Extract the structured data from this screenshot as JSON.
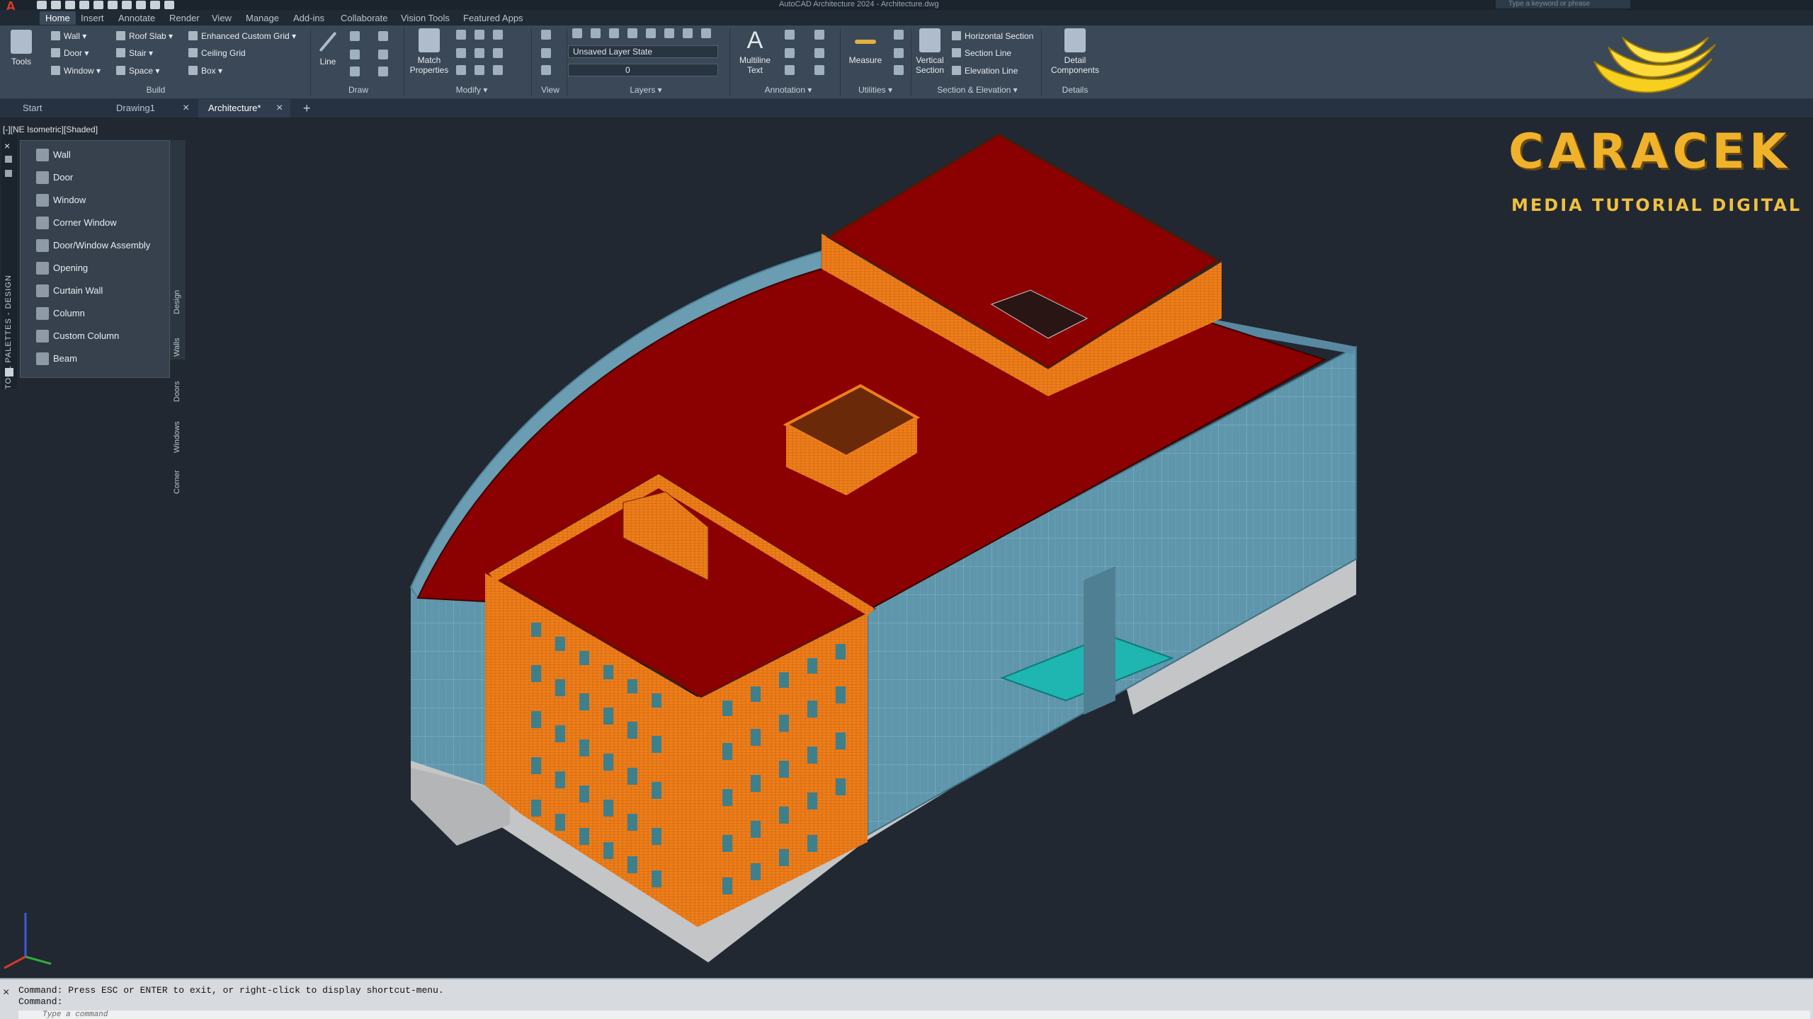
{
  "titlebar": {
    "title": "AutoCAD Architecture 2024 - Architecture.dwg",
    "search_placeholder": "Type a keyword or phrase"
  },
  "ribbon_tabs": [
    "Home",
    "Insert",
    "Annotate",
    "Render",
    "View",
    "Manage",
    "Add-ins",
    "Collaborate",
    "Vision Tools",
    "Featured Apps"
  ],
  "ribbon": {
    "tools_label": "Tools",
    "build": {
      "wall": "Wall",
      "door": "Door",
      "window": "Window",
      "roof_slab": "Roof Slab",
      "stair": "Stair",
      "space": "Space",
      "enhanced_custom_grid": "Enhanced Custom Grid",
      "ceiling_grid": "Ceiling Grid",
      "box": "Box",
      "title": "Build"
    },
    "draw": {
      "line": "Line",
      "title": "Draw"
    },
    "modify": {
      "match_properties": "Match Properties",
      "title": "Modify ▾"
    },
    "view": {
      "title": "View"
    },
    "layers": {
      "layer_state": "Unsaved Layer State",
      "layer_current": "0",
      "title": "Layers ▾"
    },
    "annotation": {
      "multiline_text": "Multiline Text",
      "title": "Annotation ▾"
    },
    "utilities": {
      "measure": "Measure",
      "title": "Utilities ▾"
    },
    "section_elevation": {
      "vertical_section": "Vertical Section",
      "horizontal_section": "Horizontal Section",
      "section_line": "Section Line",
      "elevation_line": "Elevation Line",
      "title": "Section & Elevation ▾"
    },
    "details": {
      "detail_components": "Detail Components",
      "title": "Details"
    }
  },
  "doc_tabs": [
    {
      "label": "Start"
    },
    {
      "label": "Drawing1"
    },
    {
      "label": "Architecture*"
    }
  ],
  "viewport_label": "[-][NE Isometric][Shaded]",
  "tool_palette": {
    "strip_title": "TOOL PALETTES - DESIGN",
    "items": [
      "Wall",
      "Door",
      "Window",
      "Corner Window",
      "Door/Window Assembly",
      "Opening",
      "Curtain Wall",
      "Column",
      "Custom Column",
      "Beam"
    ],
    "tabs": [
      "Design",
      "Walls",
      "Doors",
      "Windows",
      "Corner"
    ]
  },
  "command": {
    "line1": "Command:  Press ESC or ENTER to exit, or right-click to display shortcut-menu.",
    "line2": "Command:",
    "input_placeholder": "Type a command"
  },
  "watermark": {
    "title": "CARACEK",
    "subtitle": "MEDIA TUTORIAL DIGITAL"
  },
  "colors": {
    "roof": "#8b0000",
    "brick": "#ef7f1a",
    "glass": "#5f96ab",
    "base": "#c9c9c9",
    "canopy": "#1fb5b0",
    "background": "#212831"
  }
}
